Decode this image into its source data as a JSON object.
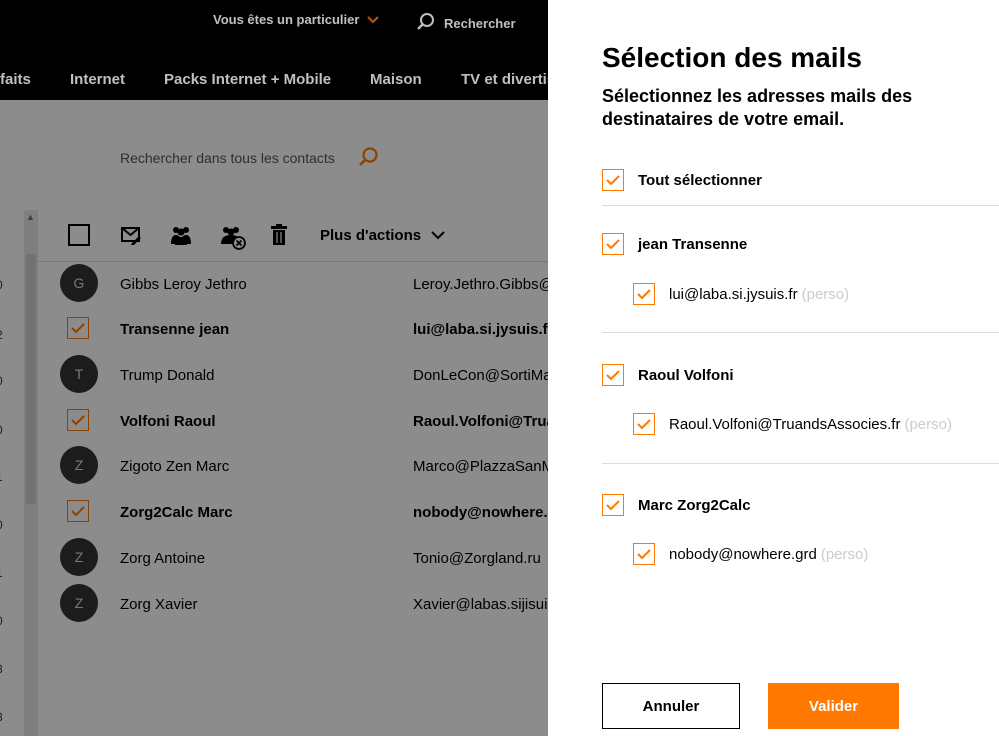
{
  "colors": {
    "accent": "#ff7900",
    "header_bg": "#000000"
  },
  "header": {
    "util_particulier": "Vous êtes un particulier",
    "util_search": "Rechercher",
    "nav": [
      "faits",
      "Internet",
      "Packs Internet + Mobile",
      "Maison",
      "TV et divertis"
    ]
  },
  "contacts": {
    "search_placeholder": "Rechercher dans tous les contacts",
    "more_actions": "Plus d'actions",
    "edge_numbers": [
      "0",
      "2",
      "0",
      "0",
      "1",
      "0",
      "1",
      "0",
      "8",
      "8"
    ],
    "rows": [
      {
        "name": "Gibbs Leroy Jethro",
        "email": "Leroy.Jethro.Gibbs@",
        "initial": "G",
        "selected": false
      },
      {
        "name": "Transenne jean",
        "email": "lui@laba.si.jysuis.fr",
        "initial": "",
        "selected": true
      },
      {
        "name": "Trump Donald",
        "email": "DonLeCon@SortiMa",
        "initial": "T",
        "selected": false
      },
      {
        "name": "Volfoni Raoul",
        "email": "Raoul.Volfoni@Trua",
        "initial": "",
        "selected": true
      },
      {
        "name": "Zigoto Zen Marc",
        "email": "Marco@PlazzaSanM",
        "initial": "Z",
        "selected": false
      },
      {
        "name": "Zorg2Calc Marc",
        "email": "nobody@nowhere.g",
        "initial": "",
        "selected": true
      },
      {
        "name": "Zorg Antoine",
        "email": "Tonio@Zorgland.ru",
        "initial": "Z",
        "selected": false
      },
      {
        "name": "Zorg Xavier",
        "email": "Xavier@labas.sijisuis",
        "initial": "Z",
        "selected": false
      }
    ]
  },
  "panel": {
    "title": "Sélection des mails",
    "subtitle": "Sélectionnez les adresses mails des destinataires de votre email.",
    "select_all": "Tout sélectionner",
    "tag": "(perso)",
    "groups": [
      {
        "name": "jean Transenne",
        "email": "lui@laba.si.jysuis.fr"
      },
      {
        "name": "Raoul Volfoni",
        "email": "Raoul.Volfoni@TruandsAssocies.fr"
      },
      {
        "name": "Marc Zorg2Calc",
        "email": "nobody@nowhere.grd"
      }
    ],
    "cancel": "Annuler",
    "confirm": "Valider"
  }
}
